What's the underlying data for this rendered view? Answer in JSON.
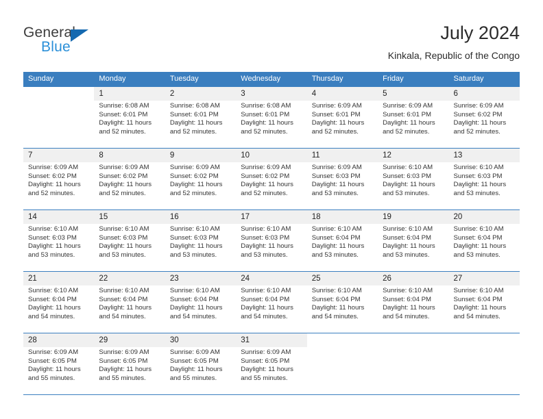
{
  "brand": {
    "name_top": "General",
    "name_bottom": "Blue",
    "flag_color": "#1569b0",
    "top_color": "#3c3c3c",
    "bottom_color": "#2a8fd8"
  },
  "header": {
    "month_title": "July 2024",
    "location": "Kinkala, Republic of the Congo",
    "header_bg": "#3a7ebf",
    "daynum_bg": "#f0f0f0"
  },
  "weekdays": [
    "Sunday",
    "Monday",
    "Tuesday",
    "Wednesday",
    "Thursday",
    "Friday",
    "Saturday"
  ],
  "weeks": [
    [
      {
        "day": "",
        "sunrise": "",
        "sunset": "",
        "daylight1": "",
        "daylight2": ""
      },
      {
        "day": "1",
        "sunrise": "Sunrise: 6:08 AM",
        "sunset": "Sunset: 6:01 PM",
        "daylight1": "Daylight: 11 hours",
        "daylight2": "and 52 minutes."
      },
      {
        "day": "2",
        "sunrise": "Sunrise: 6:08 AM",
        "sunset": "Sunset: 6:01 PM",
        "daylight1": "Daylight: 11 hours",
        "daylight2": "and 52 minutes."
      },
      {
        "day": "3",
        "sunrise": "Sunrise: 6:08 AM",
        "sunset": "Sunset: 6:01 PM",
        "daylight1": "Daylight: 11 hours",
        "daylight2": "and 52 minutes."
      },
      {
        "day": "4",
        "sunrise": "Sunrise: 6:09 AM",
        "sunset": "Sunset: 6:01 PM",
        "daylight1": "Daylight: 11 hours",
        "daylight2": "and 52 minutes."
      },
      {
        "day": "5",
        "sunrise": "Sunrise: 6:09 AM",
        "sunset": "Sunset: 6:01 PM",
        "daylight1": "Daylight: 11 hours",
        "daylight2": "and 52 minutes."
      },
      {
        "day": "6",
        "sunrise": "Sunrise: 6:09 AM",
        "sunset": "Sunset: 6:02 PM",
        "daylight1": "Daylight: 11 hours",
        "daylight2": "and 52 minutes."
      }
    ],
    [
      {
        "day": "7",
        "sunrise": "Sunrise: 6:09 AM",
        "sunset": "Sunset: 6:02 PM",
        "daylight1": "Daylight: 11 hours",
        "daylight2": "and 52 minutes."
      },
      {
        "day": "8",
        "sunrise": "Sunrise: 6:09 AM",
        "sunset": "Sunset: 6:02 PM",
        "daylight1": "Daylight: 11 hours",
        "daylight2": "and 52 minutes."
      },
      {
        "day": "9",
        "sunrise": "Sunrise: 6:09 AM",
        "sunset": "Sunset: 6:02 PM",
        "daylight1": "Daylight: 11 hours",
        "daylight2": "and 52 minutes."
      },
      {
        "day": "10",
        "sunrise": "Sunrise: 6:09 AM",
        "sunset": "Sunset: 6:02 PM",
        "daylight1": "Daylight: 11 hours",
        "daylight2": "and 52 minutes."
      },
      {
        "day": "11",
        "sunrise": "Sunrise: 6:09 AM",
        "sunset": "Sunset: 6:03 PM",
        "daylight1": "Daylight: 11 hours",
        "daylight2": "and 53 minutes."
      },
      {
        "day": "12",
        "sunrise": "Sunrise: 6:10 AM",
        "sunset": "Sunset: 6:03 PM",
        "daylight1": "Daylight: 11 hours",
        "daylight2": "and 53 minutes."
      },
      {
        "day": "13",
        "sunrise": "Sunrise: 6:10 AM",
        "sunset": "Sunset: 6:03 PM",
        "daylight1": "Daylight: 11 hours",
        "daylight2": "and 53 minutes."
      }
    ],
    [
      {
        "day": "14",
        "sunrise": "Sunrise: 6:10 AM",
        "sunset": "Sunset: 6:03 PM",
        "daylight1": "Daylight: 11 hours",
        "daylight2": "and 53 minutes."
      },
      {
        "day": "15",
        "sunrise": "Sunrise: 6:10 AM",
        "sunset": "Sunset: 6:03 PM",
        "daylight1": "Daylight: 11 hours",
        "daylight2": "and 53 minutes."
      },
      {
        "day": "16",
        "sunrise": "Sunrise: 6:10 AM",
        "sunset": "Sunset: 6:03 PM",
        "daylight1": "Daylight: 11 hours",
        "daylight2": "and 53 minutes."
      },
      {
        "day": "17",
        "sunrise": "Sunrise: 6:10 AM",
        "sunset": "Sunset: 6:03 PM",
        "daylight1": "Daylight: 11 hours",
        "daylight2": "and 53 minutes."
      },
      {
        "day": "18",
        "sunrise": "Sunrise: 6:10 AM",
        "sunset": "Sunset: 6:04 PM",
        "daylight1": "Daylight: 11 hours",
        "daylight2": "and 53 minutes."
      },
      {
        "day": "19",
        "sunrise": "Sunrise: 6:10 AM",
        "sunset": "Sunset: 6:04 PM",
        "daylight1": "Daylight: 11 hours",
        "daylight2": "and 53 minutes."
      },
      {
        "day": "20",
        "sunrise": "Sunrise: 6:10 AM",
        "sunset": "Sunset: 6:04 PM",
        "daylight1": "Daylight: 11 hours",
        "daylight2": "and 53 minutes."
      }
    ],
    [
      {
        "day": "21",
        "sunrise": "Sunrise: 6:10 AM",
        "sunset": "Sunset: 6:04 PM",
        "daylight1": "Daylight: 11 hours",
        "daylight2": "and 54 minutes."
      },
      {
        "day": "22",
        "sunrise": "Sunrise: 6:10 AM",
        "sunset": "Sunset: 6:04 PM",
        "daylight1": "Daylight: 11 hours",
        "daylight2": "and 54 minutes."
      },
      {
        "day": "23",
        "sunrise": "Sunrise: 6:10 AM",
        "sunset": "Sunset: 6:04 PM",
        "daylight1": "Daylight: 11 hours",
        "daylight2": "and 54 minutes."
      },
      {
        "day": "24",
        "sunrise": "Sunrise: 6:10 AM",
        "sunset": "Sunset: 6:04 PM",
        "daylight1": "Daylight: 11 hours",
        "daylight2": "and 54 minutes."
      },
      {
        "day": "25",
        "sunrise": "Sunrise: 6:10 AM",
        "sunset": "Sunset: 6:04 PM",
        "daylight1": "Daylight: 11 hours",
        "daylight2": "and 54 minutes."
      },
      {
        "day": "26",
        "sunrise": "Sunrise: 6:10 AM",
        "sunset": "Sunset: 6:04 PM",
        "daylight1": "Daylight: 11 hours",
        "daylight2": "and 54 minutes."
      },
      {
        "day": "27",
        "sunrise": "Sunrise: 6:10 AM",
        "sunset": "Sunset: 6:04 PM",
        "daylight1": "Daylight: 11 hours",
        "daylight2": "and 54 minutes."
      }
    ],
    [
      {
        "day": "28",
        "sunrise": "Sunrise: 6:09 AM",
        "sunset": "Sunset: 6:05 PM",
        "daylight1": "Daylight: 11 hours",
        "daylight2": "and 55 minutes."
      },
      {
        "day": "29",
        "sunrise": "Sunrise: 6:09 AM",
        "sunset": "Sunset: 6:05 PM",
        "daylight1": "Daylight: 11 hours",
        "daylight2": "and 55 minutes."
      },
      {
        "day": "30",
        "sunrise": "Sunrise: 6:09 AM",
        "sunset": "Sunset: 6:05 PM",
        "daylight1": "Daylight: 11 hours",
        "daylight2": "and 55 minutes."
      },
      {
        "day": "31",
        "sunrise": "Sunrise: 6:09 AM",
        "sunset": "Sunset: 6:05 PM",
        "daylight1": "Daylight: 11 hours",
        "daylight2": "and 55 minutes."
      },
      {
        "day": "",
        "sunrise": "",
        "sunset": "",
        "daylight1": "",
        "daylight2": ""
      },
      {
        "day": "",
        "sunrise": "",
        "sunset": "",
        "daylight1": "",
        "daylight2": ""
      },
      {
        "day": "",
        "sunrise": "",
        "sunset": "",
        "daylight1": "",
        "daylight2": ""
      }
    ]
  ]
}
